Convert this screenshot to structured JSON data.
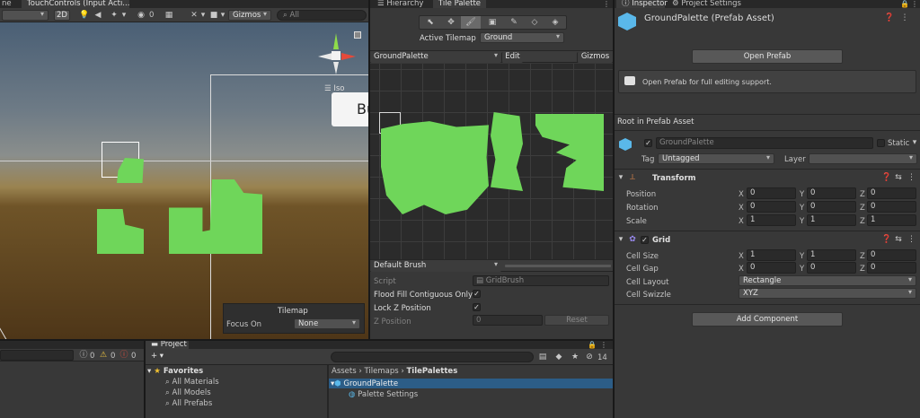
{
  "scene": {
    "tabs": [
      "ne",
      "TouchControls (Input Acti..."
    ],
    "mode_2d": "2D",
    "badge_count": "0",
    "gizmos_label": "Gizmos",
    "search_placeholder": "All",
    "view_label": "Iso",
    "ui_button_text": "Bu",
    "tilemap_overlay": {
      "title": "Tilemap",
      "focus_label": "Focus On",
      "focus_value": "None"
    }
  },
  "tile_palette": {
    "tabs": [
      "Hierarchy",
      "Tile Palette"
    ],
    "active_tilemap_label": "Active Tilemap",
    "active_tilemap_value": "Ground",
    "palette_name": "GroundPalette",
    "edit_label": "Edit",
    "gizmos_label": "Gizmos",
    "brush": "Default Brush",
    "script_label": "Script",
    "script_value": "GridBrush",
    "flood_fill_label": "Flood Fill Contiguous Only",
    "lock_z_label": "Lock Z Position",
    "z_position_label": "Z Position",
    "z_position_value": "0",
    "reset_label": "Reset"
  },
  "inspector": {
    "tabs": [
      "Inspector",
      "Project Settings"
    ],
    "asset_title": "GroundPalette (Prefab Asset)",
    "open_prefab": "Open Prefab",
    "info_text": "Open Prefab for full editing support.",
    "root_label": "Root in Prefab Asset",
    "object_name": "GroundPalette",
    "static_label": "Static",
    "tag_label": "Tag",
    "tag_value": "Untagged",
    "layer_label": "Layer",
    "layer_value": "",
    "transform": {
      "title": "Transform",
      "rows": [
        {
          "label": "Position",
          "x": "0",
          "y": "0",
          "z": "0"
        },
        {
          "label": "Rotation",
          "x": "0",
          "y": "0",
          "z": "0"
        },
        {
          "label": "Scale",
          "x": "1",
          "y": "1",
          "z": "1"
        }
      ]
    },
    "grid": {
      "title": "Grid",
      "rows": [
        {
          "label": "Cell Size",
          "x": "1",
          "y": "1",
          "z": "0"
        },
        {
          "label": "Cell Gap",
          "x": "0",
          "y": "0",
          "z": "0"
        }
      ],
      "cell_layout_label": "Cell Layout",
      "cell_layout_value": "Rectangle",
      "cell_swizzle_label": "Cell Swizzle",
      "cell_swizzle_value": "XYZ"
    },
    "add_component": "Add Component"
  },
  "console": {
    "warn_count": "0",
    "error_count": "0",
    "info_count": "0"
  },
  "project": {
    "tab": "Project",
    "add_label": "+",
    "favorites": "Favorites",
    "fav_items": [
      "All Materials",
      "All Models",
      "All Prefabs"
    ],
    "breadcrumb": [
      "Assets",
      "Tilemaps",
      "TilePalettes"
    ],
    "assets": [
      "GroundPalette",
      "Palette Settings"
    ],
    "hidden_count": "14"
  },
  "colors": {
    "tile_green": "#6fd65a",
    "panel": "#383838",
    "tab_dark": "#282828"
  }
}
